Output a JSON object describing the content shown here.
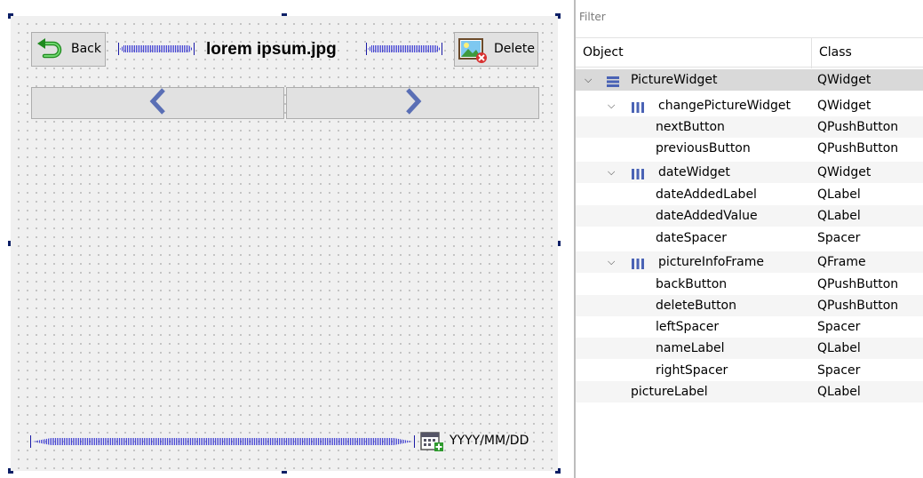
{
  "canvas": {
    "back_label": "Back",
    "file_name": "lorem ipsum.jpg",
    "delete_label": "Delete",
    "previous_icon": "chevron-left-icon",
    "next_icon": "chevron-right-icon",
    "date_value": "YYYY/MM/DD",
    "colors": {
      "arrow": "#5a6fb5",
      "selection_handle": "#0c1f66",
      "spacer": "#1a1aa6"
    }
  },
  "inspector": {
    "filter_placeholder": "Filter",
    "header_object": "Object",
    "header_class": "Class",
    "rows": [
      {
        "object": "PictureWidget",
        "class": "QWidget"
      },
      {
        "object": "changePictureWidget",
        "class": "QWidget"
      },
      {
        "object": "nextButton",
        "class": "QPushButton"
      },
      {
        "object": "previousButton",
        "class": "QPushButton"
      },
      {
        "object": "dateWidget",
        "class": "QWidget"
      },
      {
        "object": "dateAddedLabel",
        "class": "QLabel"
      },
      {
        "object": "dateAddedValue",
        "class": "QLabel"
      },
      {
        "object": "dateSpacer",
        "class": "Spacer"
      },
      {
        "object": "pictureInfoFrame",
        "class": "QFrame"
      },
      {
        "object": "backButton",
        "class": "QPushButton"
      },
      {
        "object": "deleteButton",
        "class": "QPushButton"
      },
      {
        "object": "leftSpacer",
        "class": "Spacer"
      },
      {
        "object": "nameLabel",
        "class": "QLabel"
      },
      {
        "object": "rightSpacer",
        "class": "Spacer"
      },
      {
        "object": "pictureLabel",
        "class": "QLabel"
      }
    ]
  }
}
